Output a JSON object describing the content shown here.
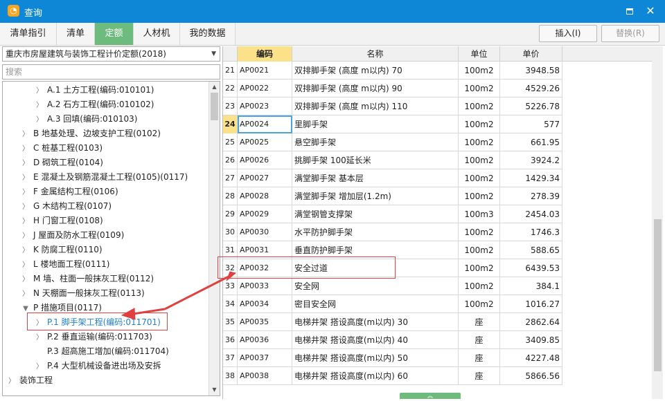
{
  "window": {
    "title": "查询"
  },
  "tabs": [
    {
      "label": "清单指引",
      "active": false
    },
    {
      "label": "清单",
      "active": false
    },
    {
      "label": "定额",
      "active": true
    },
    {
      "label": "人材机",
      "active": false
    },
    {
      "label": "我的数据",
      "active": false
    }
  ],
  "toolbar": {
    "insert_label": "插入(I)",
    "replace_label": "替换(R)"
  },
  "left_panel": {
    "library_selected": "重庆市房屋建筑与装饰工程计价定额(2018)",
    "search_placeholder": "搜索",
    "tree": [
      {
        "label": "A.1 土方工程(编码:010101)",
        "level": 2,
        "expanded": false,
        "selected": false
      },
      {
        "label": "A.2 石方工程(编码:010102)",
        "level": 2,
        "expanded": false,
        "selected": false
      },
      {
        "label": "A.3 回填(编码:010103)",
        "level": 2,
        "expanded": false,
        "selected": false
      },
      {
        "label": "B 地基处理、边坡支护工程(0102)",
        "level": 1,
        "expanded": false,
        "selected": false
      },
      {
        "label": "C 桩基工程(0103)",
        "level": 1,
        "expanded": false,
        "selected": false
      },
      {
        "label": "D 砌筑工程(0104)",
        "level": 1,
        "expanded": false,
        "selected": false
      },
      {
        "label": "E 混凝土及钢筋混凝土工程(0105)(0117)",
        "level": 1,
        "expanded": false,
        "selected": false
      },
      {
        "label": "F 金属结构工程(0106)",
        "level": 1,
        "expanded": false,
        "selected": false
      },
      {
        "label": "G 木结构工程(0107)",
        "level": 1,
        "expanded": false,
        "selected": false
      },
      {
        "label": "H 门窗工程(0108)",
        "level": 1,
        "expanded": false,
        "selected": false
      },
      {
        "label": "J 屋面及防水工程(0109)",
        "level": 1,
        "expanded": false,
        "selected": false
      },
      {
        "label": "K 防腐工程(0110)",
        "level": 1,
        "expanded": false,
        "selected": false
      },
      {
        "label": "L 楼地面工程(0111)",
        "level": 1,
        "expanded": false,
        "selected": false
      },
      {
        "label": "M 墙、柱面一般抹灰工程(0112)",
        "level": 1,
        "expanded": false,
        "selected": false
      },
      {
        "label": "N 天棚面一般抹灰工程(0113)",
        "level": 1,
        "expanded": false,
        "selected": false
      },
      {
        "label": "P 措施项目(0117)",
        "level": 1,
        "expanded": true,
        "selected": false
      },
      {
        "label": "P.1 脚手架工程(编码:011701)",
        "level": 2,
        "expanded": false,
        "selected": true
      },
      {
        "label": "P.2 垂直运输(编码:011703)",
        "level": 2,
        "expanded": false,
        "selected": false
      },
      {
        "label": "P.3 超高施工增加(编码:011704)",
        "level": 2,
        "expanded": false,
        "selected": false,
        "leaf": true
      },
      {
        "label": "P.4 大型机械设备进出场及安拆",
        "level": 2,
        "expanded": false,
        "selected": false
      },
      {
        "label": "装饰工程",
        "level": 0,
        "expanded": false,
        "selected": false
      }
    ]
  },
  "grid": {
    "columns": [
      "编码",
      "名称",
      "单位",
      "单价"
    ],
    "rows": [
      {
        "idx": "21",
        "code": "AP0021",
        "name": "双排脚手架 (高度 m以内) 70",
        "unit": "100m2",
        "price": "3948.58"
      },
      {
        "idx": "22",
        "code": "AP0022",
        "name": "双排脚手架 (高度 m以内) 90",
        "unit": "100m2",
        "price": "4529.26"
      },
      {
        "idx": "23",
        "code": "AP0023",
        "name": "双排脚手架 (高度 m以内) 110",
        "unit": "100m2",
        "price": "5226.78"
      },
      {
        "idx": "24",
        "code": "AP0024",
        "name": "里脚手架",
        "unit": "100m2",
        "price": "577",
        "current": true
      },
      {
        "idx": "25",
        "code": "AP0025",
        "name": "悬空脚手架",
        "unit": "100m2",
        "price": "661.95"
      },
      {
        "idx": "26",
        "code": "AP0026",
        "name": "挑脚手架 100延长米",
        "unit": "100m2",
        "price": "3924.2"
      },
      {
        "idx": "27",
        "code": "AP0027",
        "name": "满堂脚手架 基本层",
        "unit": "100m2",
        "price": "1429.34"
      },
      {
        "idx": "28",
        "code": "AP0028",
        "name": "满堂脚手架 增加层(1.2m)",
        "unit": "100m2",
        "price": "278.39"
      },
      {
        "idx": "29",
        "code": "AP0029",
        "name": "满堂钢管支撑架",
        "unit": "100m3",
        "price": "2454.03"
      },
      {
        "idx": "30",
        "code": "AP0030",
        "name": "水平防护脚手架",
        "unit": "100m2",
        "price": "1746.3"
      },
      {
        "idx": "31",
        "code": "AP0031",
        "name": "垂直防护脚手架",
        "unit": "100m2",
        "price": "588.65"
      },
      {
        "idx": "32",
        "code": "AP0032",
        "name": "安全过道",
        "unit": "100m2",
        "price": "6439.53"
      },
      {
        "idx": "33",
        "code": "AP0033",
        "name": "安全网",
        "unit": "100m2",
        "price": "384.1"
      },
      {
        "idx": "34",
        "code": "AP0034",
        "name": "密目安全网",
        "unit": "100m2",
        "price": "1016.27"
      },
      {
        "idx": "35",
        "code": "AP0035",
        "name": "电梯井架 搭设高度(m以内) 30",
        "unit": "座",
        "price": "2862.64"
      },
      {
        "idx": "36",
        "code": "AP0036",
        "name": "电梯井架 搭设高度(m以内) 40",
        "unit": "座",
        "price": "3409.85"
      },
      {
        "idx": "37",
        "code": "AP0037",
        "name": "电梯井架 搭设高度(m以内) 50",
        "unit": "座",
        "price": "4227.48"
      },
      {
        "idx": "38",
        "code": "AP0038",
        "name": "电梯井架 搭设高度(m以内) 60",
        "unit": "座",
        "price": "5866.56"
      }
    ]
  },
  "colors": {
    "titlebar": "#0f87d7",
    "active_tab": "#6dbb7d",
    "header_highlight": "#fbe28a",
    "annotation": "#e04040",
    "selected_tree_text": "#1f7fd0"
  }
}
